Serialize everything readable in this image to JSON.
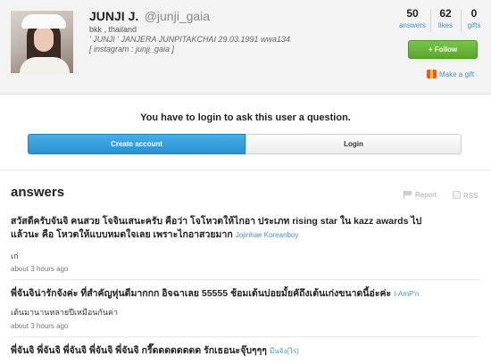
{
  "profile": {
    "name": "JUNJI J.",
    "handle": "@junji_gaia",
    "location": "bkk , thailand",
    "bio_line1": "' JUNJI ' JANJERA JUNPITAKCHAI 29.03.1991 wwa134",
    "bio_line2": "[ instagram : junji_gaia ]"
  },
  "stats": [
    {
      "value": "50",
      "label": "answers"
    },
    {
      "value": "62",
      "label": "likes"
    },
    {
      "value": "0",
      "label": "gifts"
    }
  ],
  "actions": {
    "follow_label": "+ Follow",
    "gift_label": "Make a gift"
  },
  "login": {
    "message": "You have to login to ask this user a question.",
    "create_label": "Create account",
    "login_label": "Login"
  },
  "answers_section": {
    "title": "answers",
    "report_label": "Report",
    "rss_label": "RSS"
  },
  "qa": [
    {
      "question_line1": "สวัสดีครับจันจิ คนสวย โจจินเสนะครับ คือว่า โจโหวตให้ไกอา ประเภท rising star ใน kazz awards ไป",
      "question_line2": "แล้วนะ คือ โหวตให้แบบหมดใจเลย เพราะไกอาสวยมาก",
      "asker": "Jojinhae Koreanboy",
      "answer": "เก่",
      "time": "about 3 hours ago"
    },
    {
      "question_line1": "พี่จันจิน่ารักจังค่ะ ที่สำคัญหุ่นดีมากกก อิจฉาเลย 55555 ช้อมเต้นบ่อยมั้ยคัถึงเต้นเก่งขนาดนี้อ่ะค่ะ",
      "asker": "I-AmP'n",
      "answer": "เต้นมานานหลายปีเหมือนกันค่า",
      "time": "about 3 hours ago"
    },
    {
      "question_line1": "พี่จันจิ พี่จันจิ พี่จันจิ พี่จันจิ พี่จันจิ กรี๊ดดดดดดดด รักเธอนะจุ๊บๆๆๆ",
      "asker": "มีนจัง(ไร)"
    }
  ]
}
